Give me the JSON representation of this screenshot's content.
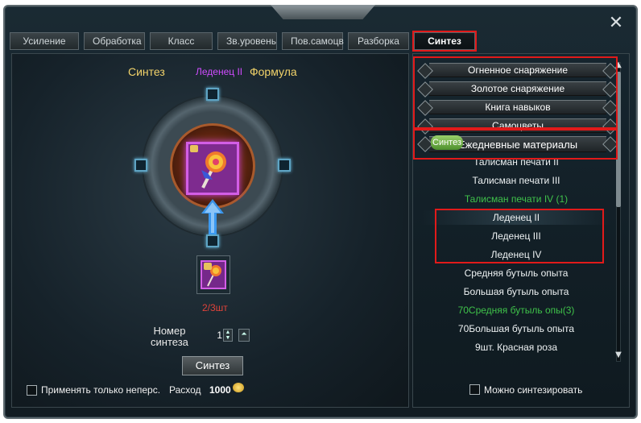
{
  "window": {
    "close_glyph": "✕"
  },
  "tabs": [
    {
      "label": "Усиление"
    },
    {
      "label": "Обработка"
    },
    {
      "label": "Класс"
    },
    {
      "label": "Зв.уровень"
    },
    {
      "label": "Пов.самоцв"
    },
    {
      "label": "Разборка"
    },
    {
      "label": "Синтез"
    }
  ],
  "synth": {
    "title": "Синтез",
    "item_name": "Леденец II",
    "formula": "Формула",
    "material_count": "2/3шт",
    "qty_label_line1": "Номер",
    "qty_label_line2": "синтеза",
    "qty_value": "1",
    "button": "Синтез",
    "only_untradable": "Применять только неперс.",
    "cost_label": "Расход",
    "cost_value": "1000"
  },
  "categories": [
    {
      "label": "Огненное снаряжение"
    },
    {
      "label": "Золотое снаряжение"
    },
    {
      "label": "Книга навыков"
    },
    {
      "label": "Самоцветы"
    },
    {
      "label": "Ежедневные материалы"
    }
  ],
  "badge": "Синтез",
  "items": [
    {
      "label": "Талисман печати II",
      "color": "white"
    },
    {
      "label": "Талисман печати III",
      "color": "white"
    },
    {
      "label": "Талисман печати IV (1)",
      "color": "green"
    },
    {
      "label": "Леденец II",
      "color": "white"
    },
    {
      "label": "Леденец III",
      "color": "white"
    },
    {
      "label": "Леденец IV",
      "color": "white"
    },
    {
      "label": "Средняя бутыль опыта",
      "color": "white"
    },
    {
      "label": "Большая бутыль опыта",
      "color": "white"
    },
    {
      "label": "70Средняя бутыль опы(3)",
      "color": "green"
    },
    {
      "label": "70Большая бутыль опыта",
      "color": "white"
    },
    {
      "label": "9шт. Красная роза",
      "color": "white"
    }
  ],
  "can_synthesize": "Можно синтезировать",
  "colors": {
    "accent_purple": "#d04cff",
    "gold": "#f2d36a",
    "green": "#3fc24a",
    "highlight_red": "#e11a1a"
  }
}
